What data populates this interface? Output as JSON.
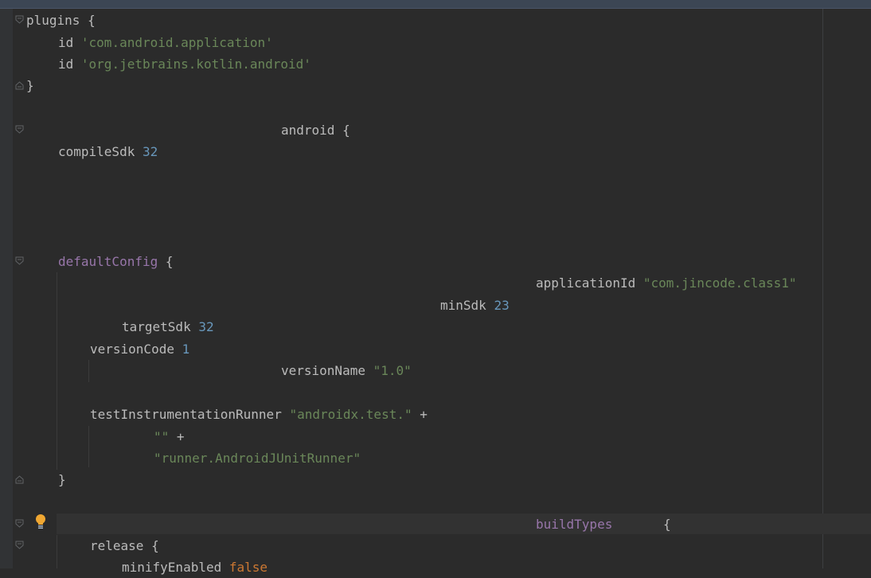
{
  "editor": {
    "lines": {
      "l1": {
        "kw": "plugins",
        "brace": " {"
      },
      "l2": {
        "kw": "id",
        "str": "'com.android.application'"
      },
      "l3": {
        "kw": "id",
        "str": "'org.jetbrains.kotlin.android'"
      },
      "l4": {
        "brace": "}"
      },
      "l5": {
        "kw": "android",
        "brace": " {"
      },
      "l6": {
        "kw": "compileSdk",
        "num": "32"
      },
      "l7": {
        "kw": "defaultConfig",
        "brace": " {"
      },
      "l8": {
        "kw": "applicationId",
        "str": "\"com.jincode.class1\""
      },
      "l9": {
        "kw": "minSdk",
        "num": "23"
      },
      "l10": {
        "kw": "targetSdk",
        "num": "32"
      },
      "l11": {
        "kw": "versionCode",
        "num": "1"
      },
      "l12": {
        "kw": "versionName",
        "str": "\"1.0\""
      },
      "l13": {
        "kw": "testInstrumentationRunner",
        "str": "\"androidx.test.\"",
        "op": " +"
      },
      "l14": {
        "str": "\"\"",
        "op": " +"
      },
      "l15": {
        "str": "\"runner.AndroidJUnitRunner\""
      },
      "l16": {
        "brace": "}"
      },
      "l17": {
        "kw": "buildTypes",
        "brace": "{"
      },
      "l18": {
        "kw": "release",
        "brace": " {"
      },
      "l19": {
        "kw": "minifyEnabled",
        "val": "false"
      }
    }
  },
  "colors": {
    "background": "#2b2b2b",
    "keyword_purple": "#9876aa",
    "string_green": "#6a8759",
    "number_blue": "#6897bb",
    "keyword_orange": "#cc7832",
    "text": "#a9b7c6"
  },
  "icons": {
    "fold_marker": "fold-icon",
    "intention": "lightbulb-icon"
  }
}
